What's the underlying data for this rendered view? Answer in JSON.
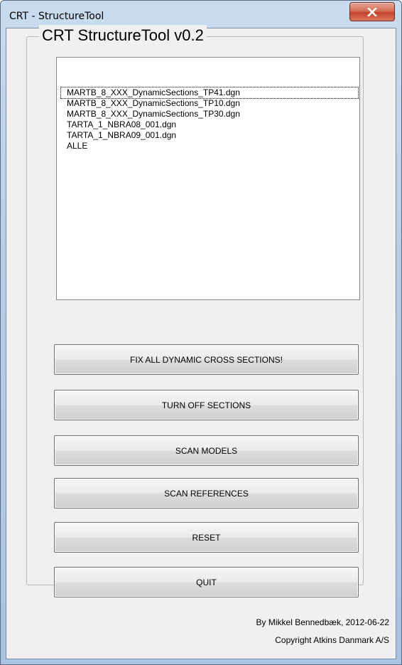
{
  "window": {
    "title": "CRT - StructureTool",
    "close_symbol": "×"
  },
  "group": {
    "title": "CRT StructureTool v0.2"
  },
  "listbox": {
    "items": [
      "MARTB_8_XXX_DynamicSections_TP41.dgn",
      "MARTB_8_XXX_DynamicSections_TP10.dgn",
      "MARTB_8_XXX_DynamicSections_TP30.dgn",
      "TARTA_1_NBRA08_001.dgn",
      "TARTA_1_NBRA09_001.dgn",
      "ALLE"
    ]
  },
  "buttons": {
    "fix_all": "FIX ALL DYNAMIC CROSS SECTIONS!",
    "turn_off": "TURN OFF SECTIONS",
    "scan_models": "SCAN MODELS",
    "scan_references": "SCAN REFERENCES",
    "reset": "RESET",
    "quit": "QUIT"
  },
  "footer": {
    "author": "By Mikkel Bennedbæk, 2012-06-22",
    "copyright": "Copyright Atkins Danmark A/S"
  },
  "colors": {
    "title_bar": "#b7cde8",
    "client_bg": "#f0f0f0",
    "close_button": "#c4442b"
  },
  "icons": {
    "close": "close-icon"
  }
}
